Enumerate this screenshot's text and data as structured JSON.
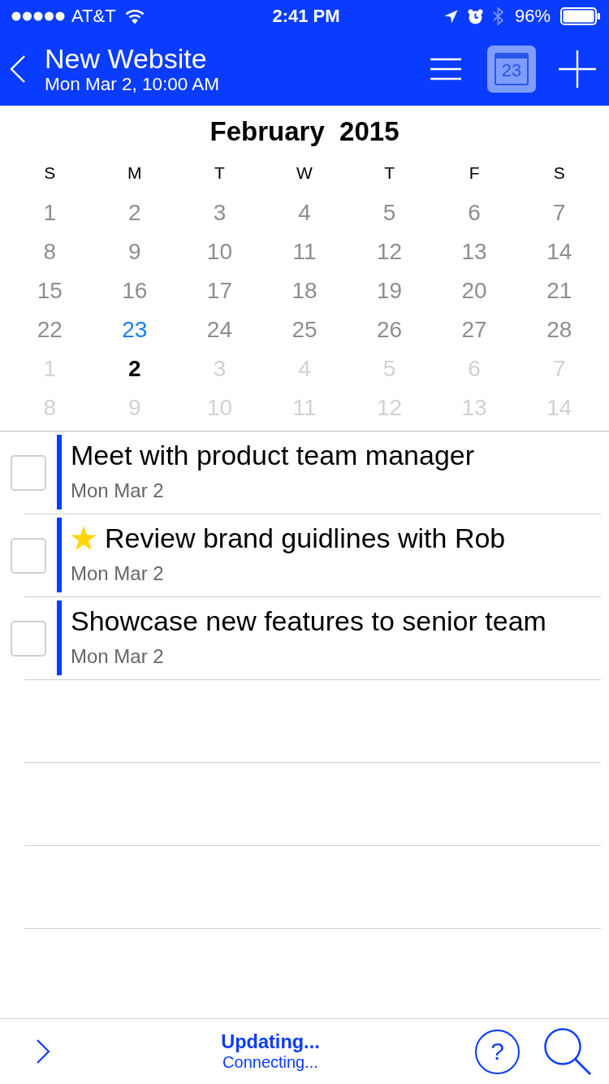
{
  "status_bar": {
    "carrier": "AT&T",
    "time": "2:41 PM",
    "battery": "96%",
    "bluetooth_connected": false
  },
  "nav_bar": {
    "title": "New Website",
    "subtitle": "Mon Mar 2, 10:00 AM",
    "calendar_button": {
      "label": "23",
      "on": true
    }
  },
  "calendar": {
    "title": "February  2015",
    "weekdays": [
      "S",
      "M",
      "T",
      "W",
      "T",
      "F",
      "S"
    ],
    "weeks": [
      [
        {
          "label": "1",
          "kind": "current",
          "today": false,
          "selected": false
        },
        {
          "label": "2",
          "kind": "current",
          "today": false,
          "selected": false
        },
        {
          "label": "3",
          "kind": "current",
          "today": false,
          "selected": false
        },
        {
          "label": "4",
          "kind": "current",
          "today": false,
          "selected": false
        },
        {
          "label": "5",
          "kind": "current",
          "today": false,
          "selected": false
        },
        {
          "label": "6",
          "kind": "current",
          "today": false,
          "selected": false
        },
        {
          "label": "7",
          "kind": "current",
          "today": false,
          "selected": false
        }
      ],
      [
        {
          "label": "8",
          "kind": "current",
          "today": false,
          "selected": false
        },
        {
          "label": "9",
          "kind": "current",
          "today": false,
          "selected": false
        },
        {
          "label": "10",
          "kind": "current",
          "today": false,
          "selected": false
        },
        {
          "label": "11",
          "kind": "current",
          "today": false,
          "selected": false
        },
        {
          "label": "12",
          "kind": "current",
          "today": false,
          "selected": false
        },
        {
          "label": "13",
          "kind": "current",
          "today": false,
          "selected": false
        },
        {
          "label": "14",
          "kind": "current",
          "today": false,
          "selected": false
        }
      ],
      [
        {
          "label": "15",
          "kind": "current",
          "today": false,
          "selected": false
        },
        {
          "label": "16",
          "kind": "current",
          "today": false,
          "selected": false
        },
        {
          "label": "17",
          "kind": "current",
          "today": false,
          "selected": false
        },
        {
          "label": "18",
          "kind": "current",
          "today": false,
          "selected": false
        },
        {
          "label": "19",
          "kind": "current",
          "today": false,
          "selected": false
        },
        {
          "label": "20",
          "kind": "current",
          "today": false,
          "selected": false
        },
        {
          "label": "21",
          "kind": "current",
          "today": false,
          "selected": false
        }
      ],
      [
        {
          "label": "22",
          "kind": "current",
          "today": false,
          "selected": false
        },
        {
          "label": "23",
          "kind": "current",
          "today": true,
          "selected": false
        },
        {
          "label": "24",
          "kind": "current",
          "today": false,
          "selected": false
        },
        {
          "label": "25",
          "kind": "current",
          "today": false,
          "selected": false
        },
        {
          "label": "26",
          "kind": "current",
          "today": false,
          "selected": false
        },
        {
          "label": "27",
          "kind": "current",
          "today": false,
          "selected": false
        },
        {
          "label": "28",
          "kind": "current",
          "today": false,
          "selected": false
        }
      ],
      [
        {
          "label": "1",
          "kind": "adjacent",
          "today": false,
          "selected": false
        },
        {
          "label": "2",
          "kind": "adjacent",
          "today": false,
          "selected": true
        },
        {
          "label": "3",
          "kind": "adjacent",
          "today": false,
          "selected": false
        },
        {
          "label": "4",
          "kind": "adjacent",
          "today": false,
          "selected": false
        },
        {
          "label": "5",
          "kind": "adjacent",
          "today": false,
          "selected": false
        },
        {
          "label": "6",
          "kind": "adjacent",
          "today": false,
          "selected": false
        },
        {
          "label": "7",
          "kind": "adjacent",
          "today": false,
          "selected": false
        }
      ],
      [
        {
          "label": "8",
          "kind": "adjacent",
          "today": false,
          "selected": false
        },
        {
          "label": "9",
          "kind": "adjacent",
          "today": false,
          "selected": false
        },
        {
          "label": "10",
          "kind": "adjacent",
          "today": false,
          "selected": false
        },
        {
          "label": "11",
          "kind": "adjacent",
          "today": false,
          "selected": false
        },
        {
          "label": "12",
          "kind": "adjacent",
          "today": false,
          "selected": false
        },
        {
          "label": "13",
          "kind": "adjacent",
          "today": false,
          "selected": false
        },
        {
          "label": "14",
          "kind": "adjacent",
          "today": false,
          "selected": false
        }
      ]
    ]
  },
  "tasks": [
    {
      "title": "Meet with product team manager",
      "date": "Mon Mar 2",
      "checked": false,
      "starred": false,
      "color": "#0a3cff"
    },
    {
      "title": "Review brand guidlines with Rob",
      "date": "Mon Mar 2",
      "checked": false,
      "starred": true,
      "color": "#0a3cff"
    },
    {
      "title": "Showcase new features to senior team",
      "date": "Mon Mar 2",
      "checked": false,
      "starred": false,
      "color": "#0a3cff"
    }
  ],
  "bottom_bar": {
    "status": "Updating...",
    "detail": "Connecting...",
    "help_button": "?"
  }
}
